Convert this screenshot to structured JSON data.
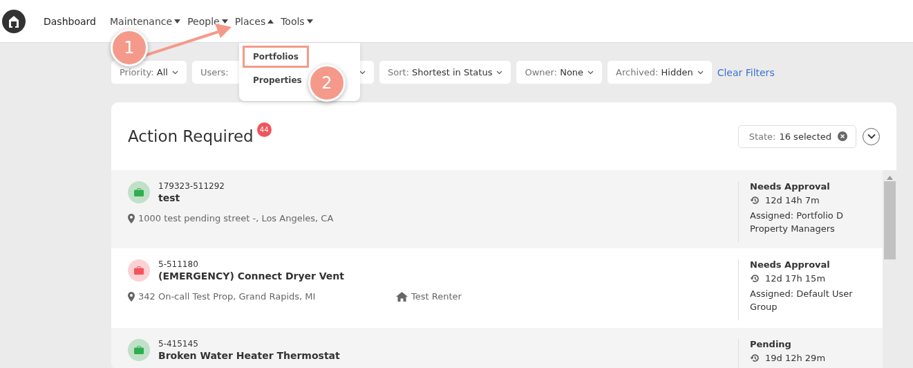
{
  "nav": {
    "items": [
      {
        "label": "Dashboard",
        "has_menu": false
      },
      {
        "label": "Maintenance",
        "has_menu": true,
        "expanded": false
      },
      {
        "label": "People",
        "has_menu": true,
        "expanded": false
      },
      {
        "label": "Places",
        "has_menu": true,
        "expanded": true
      },
      {
        "label": "Tools",
        "has_menu": true,
        "expanded": false
      }
    ]
  },
  "dropdown": {
    "items": [
      {
        "label": "Portfolios",
        "highlighted": true
      },
      {
        "label": "Properties",
        "highlighted": false
      }
    ]
  },
  "callouts": [
    {
      "number": "1"
    },
    {
      "number": "2"
    }
  ],
  "filters": [
    {
      "label": "Priority:",
      "value": "All"
    },
    {
      "label": "Users:"
    },
    {
      "label": "Sort:",
      "value": "Shortest in Status"
    },
    {
      "label": "Owner:",
      "value": "None"
    },
    {
      "label": "Archived:",
      "value": "Hidden"
    }
  ],
  "clear_filters": "Clear Filters",
  "panel": {
    "title": "Action Required",
    "count": "44",
    "state_filter": {
      "label": "State:",
      "value": "16 selected"
    }
  },
  "rows": [
    {
      "id": "179323-511292",
      "title": "test",
      "color": "#2fae4f",
      "address": "1000 test pending street -, Los Angeles, CA",
      "status": "Needs Approval",
      "time": "12d 14h 7m",
      "assigned": "Assigned: Portfolio D Property Managers"
    },
    {
      "id": "5-511180",
      "title": "(EMERGENCY) Connect Dryer Vent",
      "color": "#f2545b",
      "address": "342 On-call Test Prop, Grand Rapids, MI",
      "tenant": "Test Renter",
      "status": "Needs Approval",
      "time": "12d 17h 15m",
      "assigned": "Assigned: Default User Group"
    },
    {
      "id": "5-415145",
      "title": "Broken Water Heater Thermostat",
      "color": "#2fae4f",
      "status": "Pending",
      "time": "19d 12h 29m"
    }
  ]
}
